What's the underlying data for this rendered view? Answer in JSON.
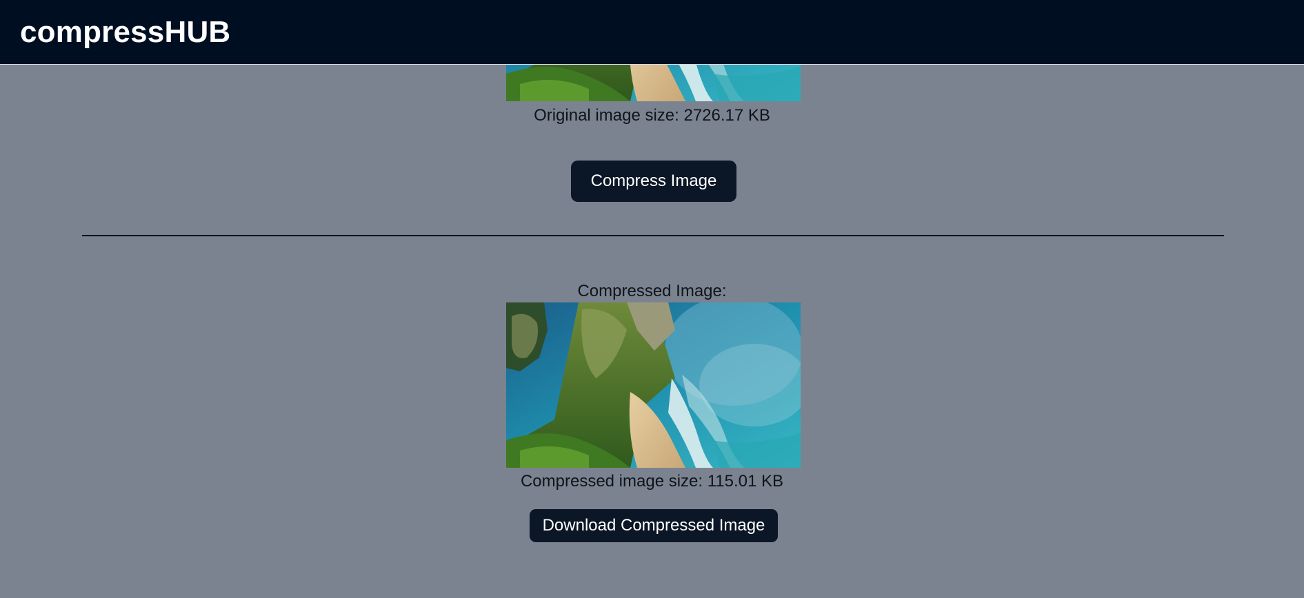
{
  "navbar": {
    "brand": "compressHUB",
    "background": "#000e22"
  },
  "original": {
    "size_label": "Original image size: 2726.17 KB",
    "compress_button_label": "Compress Image"
  },
  "compressed": {
    "heading": "Compressed Image:",
    "size_label": "Compressed image size: 115.01 KB",
    "download_button_label": "Download Compressed Image"
  },
  "colors": {
    "page_background": "#7b8391",
    "button_background": "#0b1626",
    "button_text": "#ffffff",
    "divider": "#0d1118"
  }
}
